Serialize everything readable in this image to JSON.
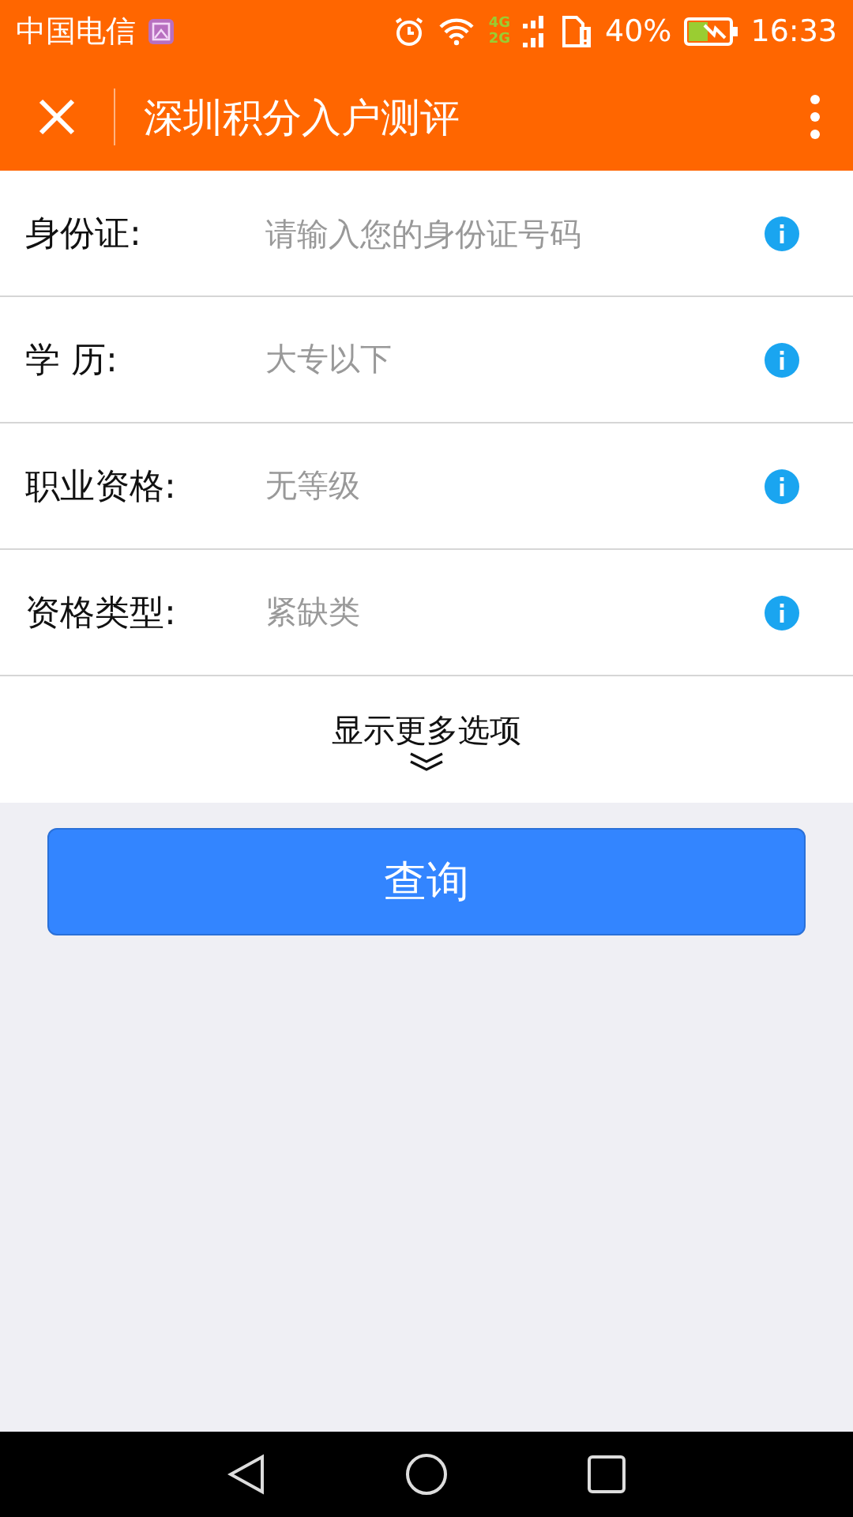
{
  "status_bar": {
    "carrier": "中国电信",
    "network_top": "4G",
    "network_bottom": "2G",
    "battery": "40%",
    "time": "16:33"
  },
  "title_bar": {
    "title": "深圳积分入户测评"
  },
  "form": {
    "rows": [
      {
        "kind": "input",
        "label": "身份证:",
        "placeholder": "请输入您的身份证号码"
      },
      {
        "kind": "select",
        "label": "学 历:",
        "value": "大专以下"
      },
      {
        "kind": "select",
        "label": "职业资格:",
        "value": "无等级"
      },
      {
        "kind": "select",
        "label": "资格类型:",
        "value": "紧缺类"
      }
    ],
    "more": {
      "label": "显示更多选项",
      "expanded": false
    }
  },
  "submit": {
    "label": "查询"
  }
}
